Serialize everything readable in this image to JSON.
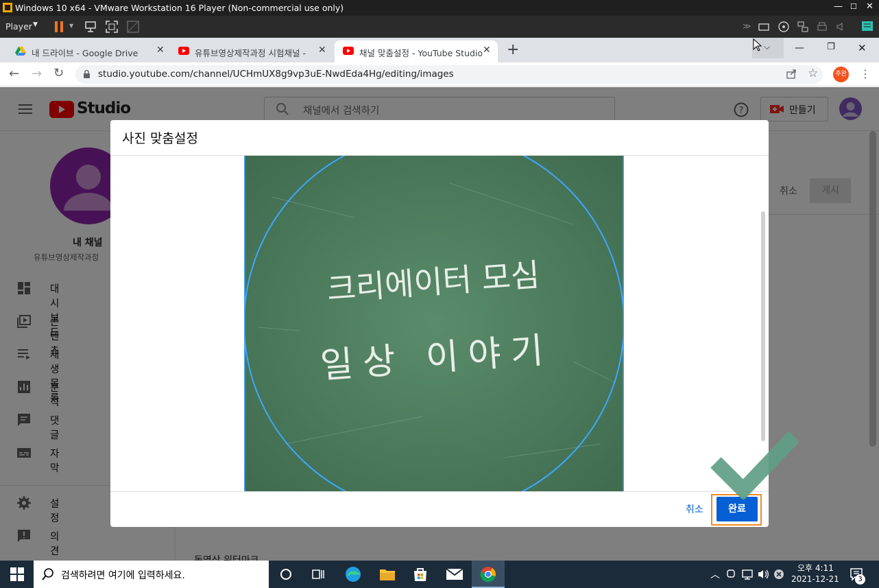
{
  "vmware": {
    "title": "Windows 10 x64 - VMware Workstation 16 Player (Non-commercial use only)",
    "player_menu": "Player"
  },
  "browser": {
    "tabs": [
      {
        "label": "내 드라이브 - Google Drive",
        "icon": "google-drive-icon"
      },
      {
        "label": "유튜브영상제작과정 시험채널 -",
        "icon": "youtube-icon"
      },
      {
        "label": "채널 맞춤설정 - YouTube Studio",
        "icon": "youtube-icon"
      }
    ],
    "url": "studio.youtube.com/channel/UCHmUX8g9vp3uE-NwdEda4Hg/editing/images",
    "profile_badge": "주완"
  },
  "studio": {
    "logo_text": "Studio",
    "search_placeholder": "채널에서 검색하기",
    "create_label": "만들기",
    "channel_name": "내 채널",
    "channel_sub": "유튜브영상제작과정",
    "nav": [
      {
        "label": "대시보드",
        "icon": "dashboard-icon"
      },
      {
        "label": "콘텐츠",
        "icon": "content-icon"
      },
      {
        "label": "재생목록",
        "icon": "playlist-icon"
      },
      {
        "label": "분석",
        "icon": "analytics-icon"
      },
      {
        "label": "댓글",
        "icon": "comments-icon"
      },
      {
        "label": "자막",
        "icon": "subtitles-icon"
      }
    ],
    "nav_bottom": [
      {
        "label": "설정",
        "icon": "settings-icon"
      },
      {
        "label": "의견 보내기",
        "icon": "feedback-icon"
      }
    ],
    "cancel_label": "취소",
    "publish_label": "게시",
    "partial_bottom_text": "동영상 워터마크"
  },
  "dialog": {
    "title": "사진 맞춤설정",
    "image_line1": "크리에이터 모심",
    "image_line2": "일상 이야기",
    "cancel_label": "취소",
    "done_label": "완료"
  },
  "taskbar": {
    "search_placeholder": "검색하려면 여기에 입력하세요.",
    "time": "오후 4:11",
    "date": "2021-12-21",
    "notification_count": "3"
  },
  "colors": {
    "chalkboard": "#4d7a5c",
    "crop_circle": "#3ea6ff",
    "done_button": "#065fd4",
    "highlight_border": "#f08a24",
    "checkmark": "#5f9e88"
  }
}
